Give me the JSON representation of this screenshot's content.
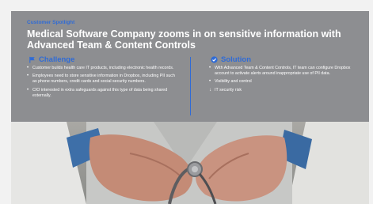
{
  "eyebrow": "Customer Spotlight",
  "headline": "Medical Software Company zooms in on sensitive information with Advanced Team & Content Controls",
  "challenge": {
    "title": "Challenge",
    "icon": "flag-icon",
    "points": [
      "Customer builds health care IT products, including electronic health records.",
      "Employees need to store sensitive information in Dropbox, including PII such as phone numbers, credit cards and social security numbers.",
      "CIO interested in extra safeguards against this type of data being shared externally."
    ]
  },
  "solution": {
    "title": "Solution",
    "icon": "check-circle-icon",
    "points": [
      {
        "marker": "•",
        "text": "With Advanced Team & Content Controls, IT team can configure Dropbox account to activate alerts around inappropriate use of PII data."
      },
      {
        "marker": "•",
        "text": "Visibility and control"
      },
      {
        "marker": "↓",
        "text": "IT security risk"
      }
    ]
  },
  "colors": {
    "accent": "#2f6bd6",
    "panel": "#8d8e91",
    "text": "#ffffff"
  },
  "image": {
    "name": "doctor-hands-stethoscope-photo"
  }
}
